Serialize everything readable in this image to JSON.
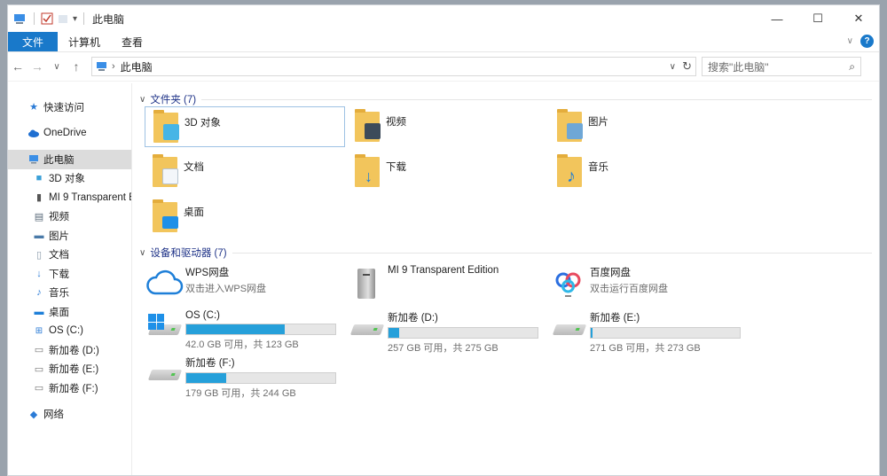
{
  "window": {
    "title": "此电脑"
  },
  "ribbon": {
    "tabs": [
      "文件",
      "计算机",
      "查看"
    ]
  },
  "address": {
    "path": "此电脑",
    "search_placeholder": "搜索\"此电脑\""
  },
  "nav": {
    "quick_access": "快速访问",
    "onedrive": "OneDrive",
    "this_pc": "此电脑",
    "items": [
      "3D 对象",
      "MI 9 Transparent E",
      "视频",
      "图片",
      "文档",
      "下载",
      "音乐",
      "桌面",
      "OS (C:)",
      "新加卷 (D:)",
      "新加卷 (E:)",
      "新加卷 (F:)"
    ],
    "network": "网络"
  },
  "groups": {
    "folders": "文件夹 (7)",
    "devices": "设备和驱动器 (7)"
  },
  "folders": [
    "3D 对象",
    "视频",
    "图片",
    "文档",
    "下载",
    "音乐",
    "桌面"
  ],
  "devices": [
    {
      "name": "WPS网盘",
      "sub": "双击进入WPS网盘"
    },
    {
      "name": "MI 9 Transparent Edition"
    },
    {
      "name": "百度网盘",
      "sub": "双击运行百度网盘"
    }
  ],
  "drives": [
    {
      "name": "OS (C:)",
      "free": "42.0 GB 可用，共 123 GB",
      "used_fraction": 0.66
    },
    {
      "name": "新加卷 (D:)",
      "free": "257 GB 可用，共 275 GB",
      "used_fraction": 0.07
    },
    {
      "name": "新加卷 (E:)",
      "free": "271 GB 可用，共 273 GB",
      "used_fraction": 0.01
    },
    {
      "name": "新加卷 (F:)",
      "free": "179 GB 可用，共 244 GB",
      "used_fraction": 0.27
    }
  ],
  "colors": {
    "accent": "#1979ca",
    "bar_fill": "#26a0da",
    "group_header": "#1e3287"
  }
}
